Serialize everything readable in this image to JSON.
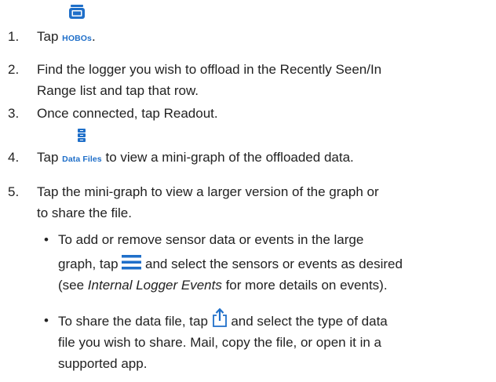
{
  "steps": [
    {
      "number": "1.",
      "before": "Tap ",
      "icon_label": "HOBOs",
      "icon": "hobo-logger-icon",
      "after": "."
    },
    {
      "number": "2.",
      "line1": "Find the logger you wish to offload in the Recently Seen/In",
      "line2": "Range list and tap that row."
    },
    {
      "number": "3.",
      "line1": "Once connected, tap Readout."
    },
    {
      "number": "4.",
      "before": "Tap ",
      "icon_label": "Data Files",
      "icon": "data-files-icon",
      "after": " to view a mini-graph of the offloaded data."
    },
    {
      "number": "5.",
      "line1": "Tap the mini-graph to view a larger version of the graph or",
      "line2": "to share the file."
    }
  ],
  "bullets": [
    {
      "symbol": "•",
      "line1": "To add or remove sensor data or events in the large",
      "line2_before": "graph, tap ",
      "icon": "menu-icon",
      "line2_after": " and select the sensors or events as desired",
      "line3_before": "(see ",
      "line3_em": "Internal Logger Events",
      "line3_after": " for more details on events)."
    },
    {
      "symbol": "•",
      "line1_before": "To share the data file, tap ",
      "icon": "share-icon",
      "line1_after": " and select the type of data",
      "line2": "file you wish to share. Mail, copy the file, or open it in a",
      "line3": "supported app."
    }
  ],
  "colors": {
    "accent": "#1f6fc9",
    "text": "#222222"
  }
}
